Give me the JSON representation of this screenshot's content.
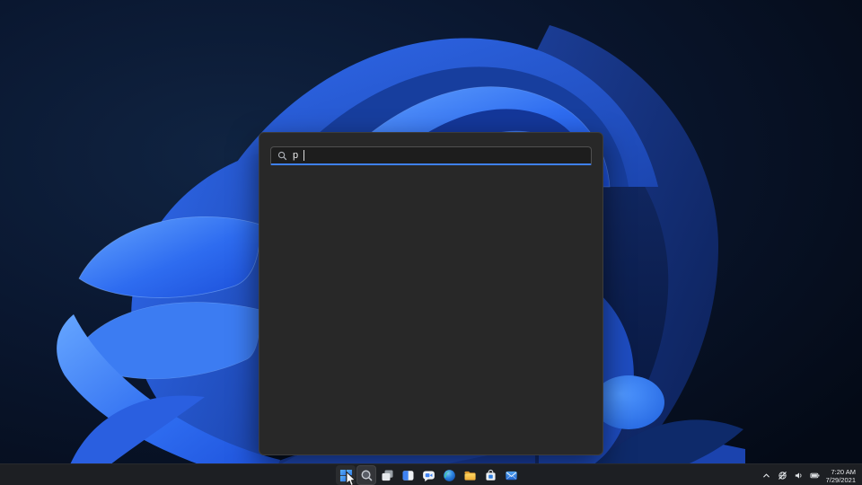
{
  "desktop": {
    "wallpaper": "windows-11-bloom"
  },
  "search_panel": {
    "query": "p",
    "search_icon": "magnifier",
    "accent_underline_color": "#3f80f0",
    "panel_bg_color": "#282828"
  },
  "taskbar": {
    "bg_color": "#1d1f23",
    "buttons": [
      {
        "icon": "windows-start-logo"
      },
      {
        "icon": "search-magnifier"
      },
      {
        "icon": "task-view"
      },
      {
        "icon": "widgets"
      },
      {
        "icon": "chat"
      },
      {
        "icon": "edge-browser"
      },
      {
        "icon": "file-explorer-folder"
      },
      {
        "icon": "store-bag"
      },
      {
        "icon": "mail-envelope"
      }
    ],
    "tray": {
      "hidden_icons_chevron": "chevron-up",
      "icons": [
        "network-status",
        "volume",
        "battery"
      ],
      "time": "7:20 AM",
      "date": "7/29/2021"
    }
  },
  "colors": {
    "accent": "#3f80f0",
    "bloom_bright": "#2e6cf0",
    "bloom_dark": "#0c2056",
    "background_navy": "#060d1c"
  }
}
